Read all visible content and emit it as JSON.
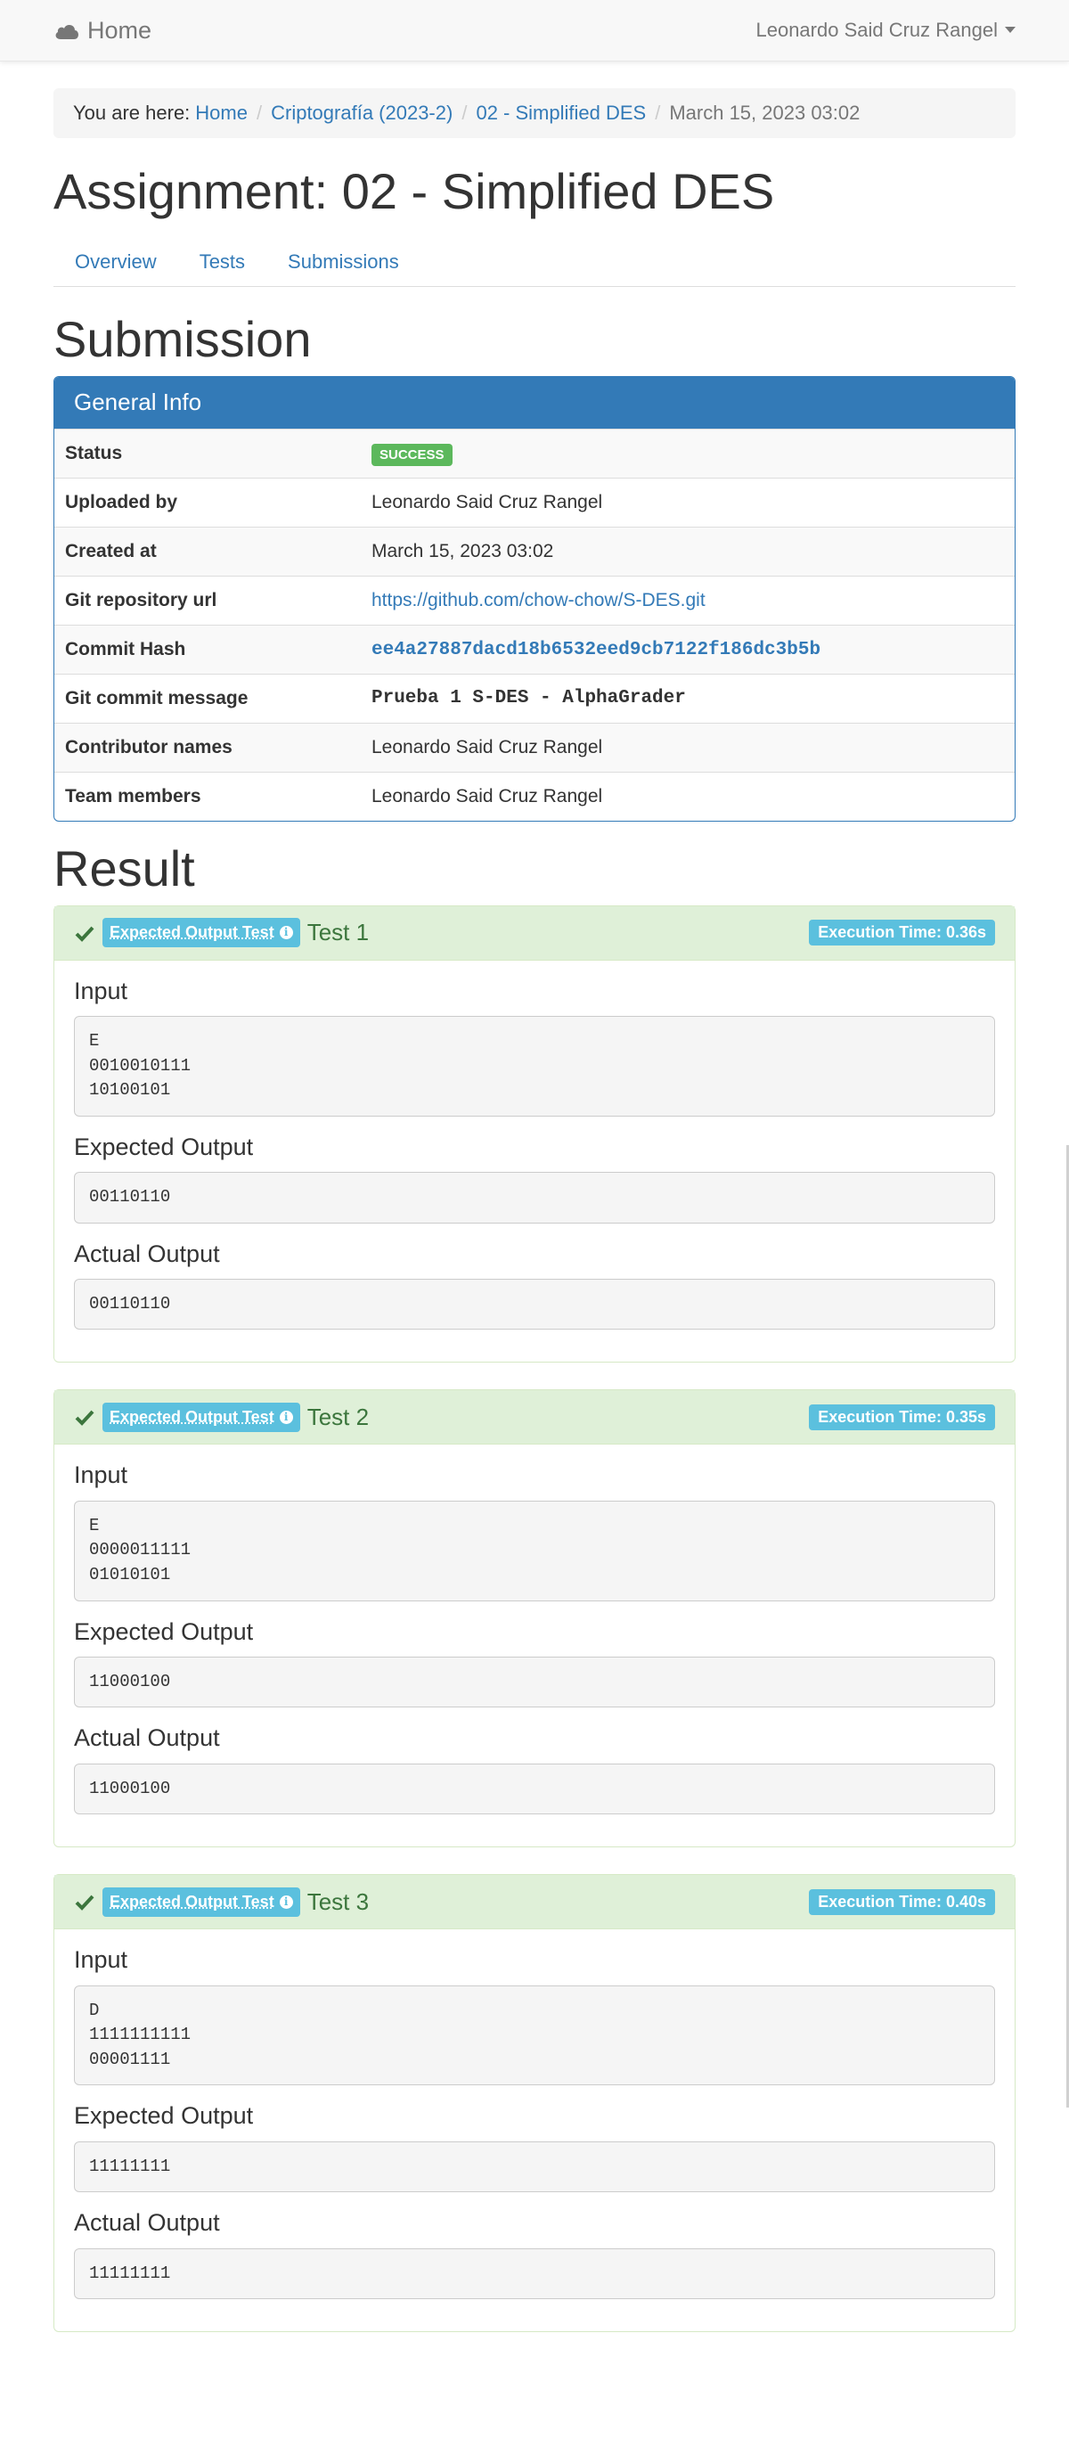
{
  "nav": {
    "brand": "Home",
    "user": "Leonardo Said Cruz Rangel"
  },
  "breadcrumb": {
    "lead": "You are here:",
    "items": [
      "Home",
      "Criptografía (2023-2)",
      "02 - Simplified DES"
    ],
    "current": "March 15, 2023 03:02"
  },
  "assignment_title": "Assignment: 02 - Simplified DES",
  "tabs": [
    "Overview",
    "Tests",
    "Submissions"
  ],
  "submission_heading": "Submission",
  "general_info": {
    "heading": "General Info",
    "status_label": "Status",
    "status_value": "SUCCESS",
    "uploaded_label": "Uploaded by",
    "uploaded_value": "Leonardo Said Cruz Rangel",
    "created_label": "Created at",
    "created_value": "March 15, 2023 03:02",
    "repo_label": "Git repository url",
    "repo_value": "https://github.com/chow-chow/S-DES.git",
    "hash_label": "Commit Hash",
    "hash_value": "ee4a27887dacd18b6532eed9cb7122f186dc3b5b",
    "message_label": "Git commit message",
    "message_value": "Prueba 1 S-DES - AlphaGrader",
    "contributors_label": "Contributor names",
    "contributors_value": "Leonardo Said Cruz Rangel",
    "team_label": "Team members",
    "team_value": "Leonardo Said Cruz Rangel"
  },
  "result_heading": "Result",
  "labels": {
    "input": "Input",
    "expected": "Expected Output",
    "actual": "Actual Output",
    "test_type": "Expected Output Test"
  },
  "tests": [
    {
      "name": "Test 1",
      "time": "Execution Time: 0.36s",
      "input": "E\n0010010111\n10100101",
      "expected": "00110110",
      "actual": "00110110"
    },
    {
      "name": "Test 2",
      "time": "Execution Time: 0.35s",
      "input": "E\n0000011111\n01010101",
      "expected": "11000100",
      "actual": "11000100"
    },
    {
      "name": "Test 3",
      "time": "Execution Time: 0.40s",
      "input": "D\n1111111111\n00001111",
      "expected": "11111111",
      "actual": "11111111"
    }
  ],
  "colors": {
    "primary": "#337ab7",
    "success": "#5cb85c",
    "info": "#5bc0de",
    "success_bg": "#dff0d8"
  }
}
